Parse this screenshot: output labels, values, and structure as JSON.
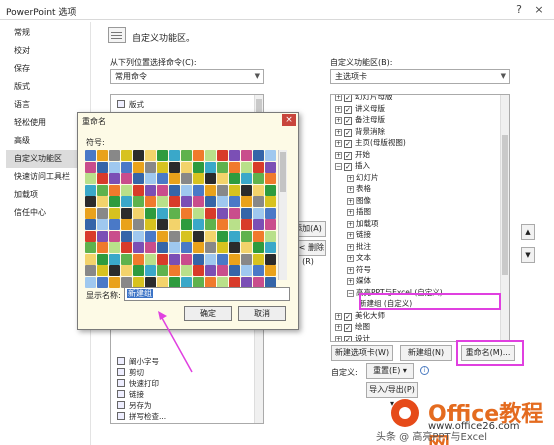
{
  "window": {
    "title": "PowerPoint 选项",
    "help": "?",
    "close": "×"
  },
  "nav": {
    "items": [
      "常规",
      "校对",
      "保存",
      "版式",
      "语言",
      "轻松使用",
      "高级",
      "自定义功能区",
      "快速访问工具栏",
      "加载项",
      "信任中心"
    ],
    "active_index": 7
  },
  "header": {
    "title": "自定义功能区。"
  },
  "left_panel": {
    "label": "从下列位置选择命令(C):",
    "dropdown_value": "常用命令",
    "items_top": [
      "版式"
    ],
    "items_bottom": [
      "阐小字号",
      "剪切",
      "快速打印",
      "链接",
      "另存为",
      "拼写检查..."
    ]
  },
  "right_panel": {
    "label": "自定义功能区(B):",
    "dropdown_value": "主选项卡",
    "tree": [
      {
        "indent": 0,
        "exp": "+",
        "chk": true,
        "text": "幻灯片母版"
      },
      {
        "indent": 0,
        "exp": "+",
        "chk": true,
        "text": "讲义母版"
      },
      {
        "indent": 0,
        "exp": "+",
        "chk": true,
        "text": "备注母版"
      },
      {
        "indent": 0,
        "exp": "+",
        "chk": true,
        "text": "背景消除"
      },
      {
        "indent": 0,
        "exp": "+",
        "chk": true,
        "text": "主页(母版视图)"
      },
      {
        "indent": 0,
        "exp": "+",
        "chk": true,
        "text": "开始"
      },
      {
        "indent": 0,
        "exp": "−",
        "chk": true,
        "text": "插入"
      },
      {
        "indent": 1,
        "exp": "+",
        "chk": false,
        "text": "幻灯片"
      },
      {
        "indent": 1,
        "exp": "+",
        "chk": false,
        "text": "表格"
      },
      {
        "indent": 1,
        "exp": "+",
        "chk": false,
        "text": "图像"
      },
      {
        "indent": 1,
        "exp": "+",
        "chk": false,
        "text": "插图"
      },
      {
        "indent": 1,
        "exp": "+",
        "chk": false,
        "text": "加载项"
      },
      {
        "indent": 1,
        "exp": "+",
        "chk": false,
        "text": "链接"
      },
      {
        "indent": 1,
        "exp": "+",
        "chk": false,
        "text": "批注"
      },
      {
        "indent": 1,
        "exp": "+",
        "chk": false,
        "text": "文本"
      },
      {
        "indent": 1,
        "exp": "+",
        "chk": false,
        "text": "符号"
      },
      {
        "indent": 1,
        "exp": "+",
        "chk": false,
        "text": "媒体"
      },
      {
        "indent": 1,
        "exp": "−",
        "chk": false,
        "text": "高亮PPT与Excel (自定义)"
      },
      {
        "indent": 2,
        "exp": "",
        "chk": false,
        "text": "新建组 (自定义)"
      },
      {
        "indent": 0,
        "exp": "+",
        "chk": true,
        "text": "美化大师"
      },
      {
        "indent": 0,
        "exp": "+",
        "chk": true,
        "text": "绘图"
      },
      {
        "indent": 0,
        "exp": "+",
        "chk": true,
        "text": "设计"
      }
    ],
    "buttons": {
      "new_tab": "新建选项卡(W)",
      "new_group": "新建组(N)",
      "rename": "重命名(M)..."
    },
    "customize_label": "自定义:",
    "reset_label": "重置(E) ▾",
    "import_export_label": "导入/导出(P) ▾",
    "info_icon": "i"
  },
  "middle_buttons": {
    "add": "添加(A) >>",
    "remove": "<< 删除(R)"
  },
  "dialog": {
    "title": "重命名",
    "close": "×",
    "symbol_label": "符号:",
    "name_label": "显示名称:",
    "name_value": "新建组",
    "ok": "确定",
    "cancel": "取消"
  },
  "watermark": {
    "brand": "Office教程网",
    "url": "www.office26.com",
    "signature": "头条 @ 高亮PPT与Excel"
  },
  "colors": {
    "highlight": "#e040e0",
    "selected_nav": "#dcdcdc",
    "dialog_bg": "#fdfae6",
    "close_red": "#c8453c",
    "brand_orange": "#e46b1f"
  }
}
